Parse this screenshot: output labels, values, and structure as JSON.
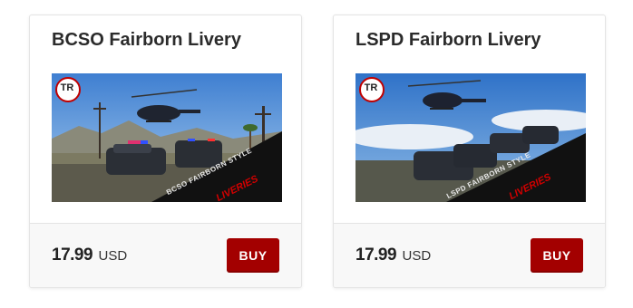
{
  "products": [
    {
      "title": "BCSO Fairborn Livery",
      "price": "17.99",
      "currency": "USD",
      "buy_label": "BUY",
      "image": {
        "logo_text": "TR",
        "banner_line1": "BCSO FAIRBORN STYLE",
        "banner_line2": "LIVERIES"
      }
    },
    {
      "title": "LSPD Fairborn Livery",
      "price": "17.99",
      "currency": "USD",
      "buy_label": "BUY",
      "image": {
        "logo_text": "TR",
        "banner_line1": "LSPD FAIRBORN STYLE",
        "banner_line2": "LIVERIES"
      }
    }
  ],
  "colors": {
    "buy_button": "#a30000",
    "banner_accent": "#d10000"
  }
}
